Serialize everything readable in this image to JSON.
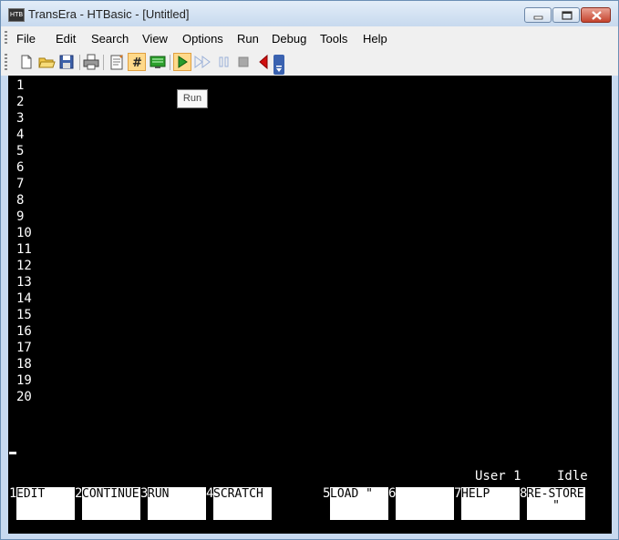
{
  "window": {
    "title": "TransEra - HTBasic - [Untitled]",
    "app_icon_text": "HTB"
  },
  "menubar": {
    "items": [
      "File",
      "Edit",
      "Search",
      "View",
      "Options",
      "Run",
      "Debug",
      "Tools",
      "Help"
    ]
  },
  "toolbar": {
    "buttons": [
      "new-file",
      "open-folder",
      "save",
      "print",
      "edit-program",
      "line-numbers",
      "display-toggle",
      "run",
      "continue",
      "pause",
      "stop",
      "step-back"
    ]
  },
  "tooltip": {
    "text": "Run"
  },
  "editor": {
    "line_numbers": [
      "1",
      "2",
      "3",
      "4",
      "5",
      "6",
      "7",
      "8",
      "9",
      "10",
      "11",
      "12",
      "13",
      "14",
      "15",
      "16",
      "17",
      "18",
      "19",
      "20"
    ]
  },
  "status": {
    "mode": "User 1",
    "state": "Idle"
  },
  "softkeys": [
    {
      "num": "1",
      "line1": "EDIT",
      "line2": ""
    },
    {
      "num": "2",
      "line1": "CONTINUE",
      "line2": ""
    },
    {
      "num": "3",
      "line1": " RUN",
      "line2": ""
    },
    {
      "num": "4",
      "line1": "SCRATCH",
      "line2": ""
    },
    {
      "num": "5",
      "line1": "LOAD \"",
      "line2": ""
    },
    {
      "num": "6",
      "line1": "",
      "line2": ""
    },
    {
      "num": "7",
      "line1": "HELP",
      "line2": ""
    },
    {
      "num": "8",
      "line1": "RE-STORE",
      "line2": "\""
    }
  ],
  "colors": {
    "screen_bg": "#000000",
    "screen_text": "#ffffff",
    "run_green": "#2a9a2a",
    "back_red": "#d01010"
  }
}
